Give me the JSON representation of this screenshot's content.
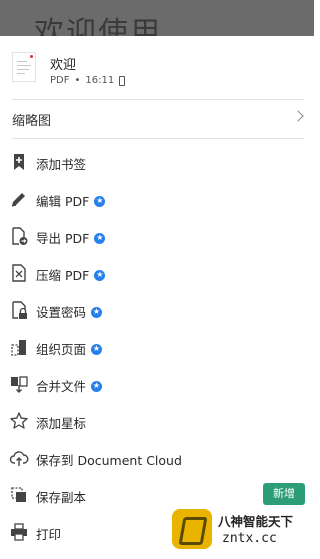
{
  "background": {
    "title": "欢迎使用"
  },
  "file": {
    "name": "欢迎",
    "type": "PDF",
    "separator": "•",
    "time": "16:11"
  },
  "thumbnails": {
    "label": "缩略图"
  },
  "menu": [
    {
      "label": "添加书签",
      "icon": "bookmark-add-icon",
      "premium": false
    },
    {
      "label": "编辑 PDF",
      "icon": "pencil-icon",
      "premium": true
    },
    {
      "label": "导出 PDF",
      "icon": "export-pdf-icon",
      "premium": true
    },
    {
      "label": "压缩 PDF",
      "icon": "compress-pdf-icon",
      "premium": true
    },
    {
      "label": "设置密码",
      "icon": "password-lock-icon",
      "premium": true
    },
    {
      "label": "组织页面",
      "icon": "organize-pages-icon",
      "premium": true
    },
    {
      "label": "合并文件",
      "icon": "combine-files-icon",
      "premium": true
    },
    {
      "label": "添加星标",
      "icon": "star-outline-icon",
      "premium": false
    },
    {
      "label": "保存到 Document Cloud",
      "icon": "cloud-upload-icon",
      "premium": false
    },
    {
      "label": "保存副本",
      "icon": "copy-icon",
      "premium": false,
      "badge": "新增"
    },
    {
      "label": "打印",
      "icon": "printer-icon",
      "premium": false
    }
  ],
  "watermark": {
    "line1": "八神智能天下",
    "line2": "zntx.cc"
  },
  "colors": {
    "premium": "#2680eb",
    "badge": "#2d9d78",
    "icon": "#444444"
  }
}
